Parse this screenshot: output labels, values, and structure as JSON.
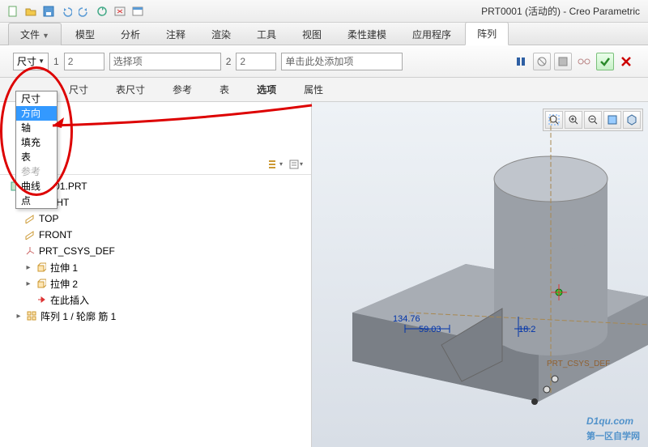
{
  "title": "PRT0001 (活动的) - Creo Parametric",
  "ribbon": {
    "file": "文件",
    "tabs": [
      "模型",
      "分析",
      "注释",
      "渲染",
      "工具",
      "视图",
      "柔性建模",
      "应用程序",
      "阵列"
    ],
    "active": "阵列"
  },
  "dashboard": {
    "type_value": "尺寸",
    "n1_label": "1",
    "n1_value": "2",
    "select_placeholder": "选择项",
    "n2_label": "2",
    "n2_value": "2",
    "click_placeholder": "单击此处添加项"
  },
  "type_dropdown": {
    "options": [
      "尺寸",
      "方向",
      "轴",
      "填充",
      "表",
      "参考",
      "曲线",
      "点"
    ],
    "selected": "方向",
    "disabled": [
      "参考"
    ]
  },
  "subtabs": [
    "尺寸",
    "表尺寸",
    "参考",
    "表",
    "选项",
    "属性"
  ],
  "subtab_active": "选项",
  "tree": {
    "root": "PRT0001.PRT",
    "items": [
      {
        "label": "RIGHT",
        "icon": "plane"
      },
      {
        "label": "TOP",
        "icon": "plane"
      },
      {
        "label": "FRONT",
        "icon": "plane"
      },
      {
        "label": "PRT_CSYS_DEF",
        "icon": "csys"
      },
      {
        "label": "拉伸 1",
        "icon": "extrude",
        "exp": true
      },
      {
        "label": "拉伸 2",
        "icon": "extrude",
        "exp": true
      },
      {
        "label": "在此插入",
        "icon": "insert"
      },
      {
        "label": "阵列 1 / 轮廓 筋 1",
        "icon": "pattern",
        "exp": true
      }
    ]
  },
  "viewport": {
    "dims": {
      "d1": "134.76",
      "d2": "59.03",
      "d3": "18.2"
    },
    "csys": "PRT_CSYS_DEF"
  },
  "watermark": {
    "main": "D1qu.com",
    "sub": "第一区自学网"
  }
}
